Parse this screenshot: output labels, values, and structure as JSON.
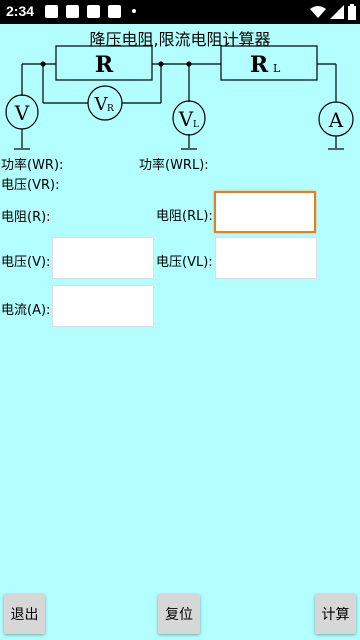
{
  "status_bar": {
    "time": "2:34"
  },
  "title": "降压电阻,限流电阻计算器",
  "circuit": {
    "resistor_r": "R",
    "resistor_rl_main": "R",
    "resistor_rl_sub": "L",
    "meter_v": "V",
    "meter_vr_main": "V",
    "meter_vr_sub": "R",
    "meter_vl_main": "V",
    "meter_vl_sub": "L",
    "meter_a": "A"
  },
  "labels": {
    "power_wr": "功率(WR):",
    "power_wrl": "功率(WRL):",
    "voltage_vr": "电压(VR):",
    "resistance_r": "电阻(R):",
    "resistance_rl": "电阻(RL):",
    "voltage_v": "电压(V):",
    "voltage_vl": "电压(VL):",
    "current_a": "电流(A):"
  },
  "fields": {
    "resistance_rl": "",
    "voltage_v": "",
    "voltage_vl": "",
    "current_a": ""
  },
  "buttons": {
    "exit": "退出",
    "reset": "复位",
    "calculate": "计算"
  }
}
